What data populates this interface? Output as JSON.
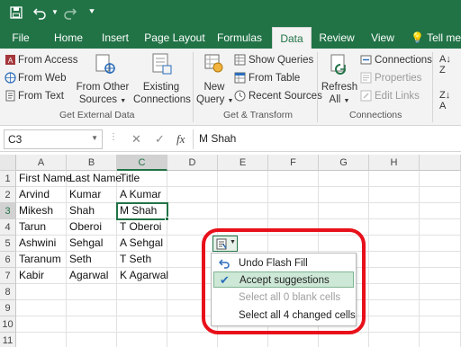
{
  "ribbon": {
    "tabs": [
      {
        "label": "File"
      },
      {
        "label": "Home"
      },
      {
        "label": "Insert"
      },
      {
        "label": "Page Layout"
      },
      {
        "label": "Formulas"
      },
      {
        "label": "Data"
      },
      {
        "label": "Review"
      },
      {
        "label": "View"
      },
      {
        "label": "Tell me"
      }
    ],
    "active_tab": "Data",
    "get_external_data": {
      "from_access": "From Access",
      "from_web": "From Web",
      "from_text": "From Text",
      "from_other_sources_1": "From Other",
      "from_other_sources_2": "Sources",
      "existing_connections_1": "Existing",
      "existing_connections_2": "Connections",
      "group_label": "Get External Data"
    },
    "get_transform": {
      "new_query_1": "New",
      "new_query_2": "Query",
      "show_queries": "Show Queries",
      "from_table": "From Table",
      "recent_sources": "Recent Sources",
      "group_label": "Get & Transform"
    },
    "connections": {
      "refresh_all_1": "Refresh",
      "refresh_all_2": "All",
      "connections": "Connections",
      "properties": "Properties",
      "edit_links": "Edit Links",
      "group_label": "Connections"
    }
  },
  "formula_bar": {
    "name_box": "C3",
    "cancel": "✕",
    "enter": "✓",
    "fx": "fx",
    "formula": "M Shah"
  },
  "sheet": {
    "columns": [
      "A",
      "B",
      "C",
      "D",
      "E",
      "F",
      "G",
      "H"
    ],
    "rows": [
      "1",
      "2",
      "3",
      "4",
      "5",
      "6",
      "7",
      "8",
      "9",
      "10",
      "11"
    ],
    "data": [
      [
        "First Name",
        "Last Name",
        "Title"
      ],
      [
        "Arvind",
        "Kumar",
        "A Kumar"
      ],
      [
        "Mikesh",
        "Shah",
        "M Shah"
      ],
      [
        "Tarun",
        "Oberoi",
        "T Oberoi"
      ],
      [
        "Ashwini",
        "Sehgal",
        "A Sehgal"
      ],
      [
        "Taranum",
        "Seth",
        "T Seth"
      ],
      [
        "Kabir",
        "Agarwal",
        "K Agarwal"
      ]
    ],
    "active_cell": "C3"
  },
  "flash_fill_menu": {
    "undo": "Undo Flash Fill",
    "accept": "Accept suggestions",
    "select_blank": "Select all 0 blank cells",
    "select_changed": "Select all 4 changed cells"
  },
  "colors": {
    "excel_green": "#217346",
    "highlight": "#cde8d6",
    "annotation_red": "#e8101a"
  }
}
